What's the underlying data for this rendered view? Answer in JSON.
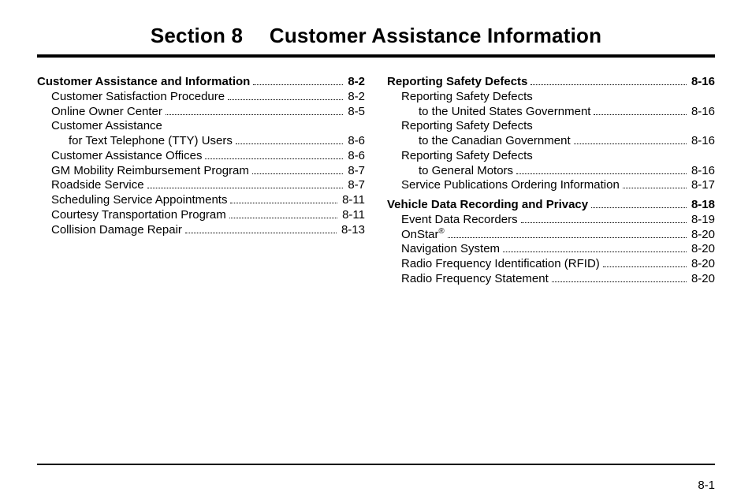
{
  "title": "Section 8  Customer Assistance Information",
  "page_number": "8-1",
  "left_column": [
    {
      "label": "Customer Assistance and Information",
      "page": "8-2",
      "indent": 0,
      "bold": true
    },
    {
      "label": "Customer Satisfaction Procedure",
      "page": "8-2",
      "indent": 1
    },
    {
      "label": "Online Owner Center",
      "page": "8-5",
      "indent": 1
    },
    {
      "label": "Customer Assistance",
      "indent": 1,
      "continuation_only": true
    },
    {
      "label": "for Text Telephone (TTY) Users",
      "page": "8-6",
      "indent": 2
    },
    {
      "label": "Customer Assistance Offices",
      "page": "8-6",
      "indent": 1
    },
    {
      "label": "GM Mobility Reimbursement Program",
      "page": "8-7",
      "indent": 1
    },
    {
      "label": "Roadside Service",
      "page": "8-7",
      "indent": 1
    },
    {
      "label": "Scheduling Service Appointments",
      "page": "8-11",
      "indent": 1
    },
    {
      "label": "Courtesy Transportation Program",
      "page": "8-11",
      "indent": 1
    },
    {
      "label": "Collision Damage Repair",
      "page": "8-13",
      "indent": 1
    }
  ],
  "right_column": [
    {
      "label": "Reporting Safety Defects",
      "page": "8-16",
      "indent": 0,
      "bold": true
    },
    {
      "label": "Reporting Safety Defects",
      "indent": 1,
      "continuation_only": true
    },
    {
      "label": "to the United States Government",
      "page": "8-16",
      "indent": 2
    },
    {
      "label": "Reporting Safety Defects",
      "indent": 1,
      "continuation_only": true
    },
    {
      "label": "to the Canadian Government",
      "page": "8-16",
      "indent": 2
    },
    {
      "label": "Reporting Safety Defects",
      "indent": 1,
      "continuation_only": true
    },
    {
      "label": "to General Motors",
      "page": "8-16",
      "indent": 2
    },
    {
      "label": "Service Publications Ordering Information",
      "page": "8-17",
      "indent": 1
    },
    {
      "label": "Vehicle Data Recording and Privacy",
      "page": "8-18",
      "indent": 0,
      "bold": true,
      "gap_before": true
    },
    {
      "label": "Event Data Recorders",
      "page": "8-19",
      "indent": 1
    },
    {
      "label": "OnStar",
      "page": "8-20",
      "indent": 1,
      "sup": "®"
    },
    {
      "label": "Navigation System",
      "page": "8-20",
      "indent": 1
    },
    {
      "label": "Radio Frequency Identification (RFID)",
      "page": "8-20",
      "indent": 1
    },
    {
      "label": "Radio Frequency Statement",
      "page": "8-20",
      "indent": 1
    }
  ]
}
